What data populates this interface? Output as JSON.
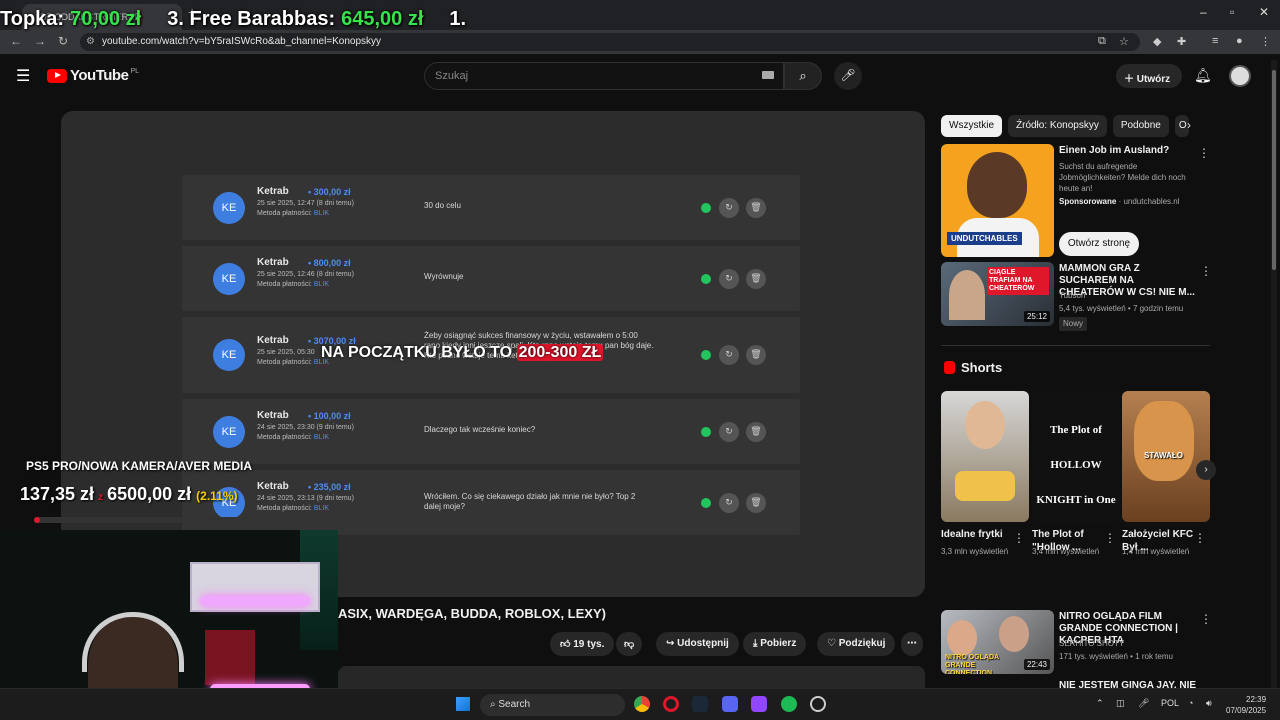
{
  "browser": {
    "tab_title": "DZ ODDAL STRIMERCE",
    "url": "youtube.com/watch?v=bY5raISWcRo&ab_channel=Konopskyy"
  },
  "overlay_top": {
    "label": "Topka:",
    "amount1": "70,00 zł",
    "entry3": "3. Free Barabbas:",
    "amount3": "645,00 zł",
    "entry1": "1."
  },
  "header": {
    "logo": "YouTube",
    "logo_country": "PL",
    "search_placeholder": "Szukaj",
    "create_label": "Utwórz"
  },
  "donations": [
    {
      "initials": "KE",
      "name": "Ketrab",
      "amount": "300,00 zł",
      "date": "25 sie 2025, 12:47 (8 dni temu)",
      "method_label": "Metoda płatności:",
      "method": "BLIK",
      "message": "30 do celu"
    },
    {
      "initials": "KE",
      "name": "Ketrab",
      "amount": "800,00 zł",
      "date": "25 sie 2025, 12:46 (8 dni temu)",
      "method_label": "Metoda płatności:",
      "method": "BLIK",
      "message": "Wyrównuje"
    },
    {
      "initials": "KE",
      "name": "Ketrab",
      "amount": "3070,00 zł",
      "date": "25 sie 2025, 05:30",
      "method_label": "Metoda płatności:",
      "method": "BLIK",
      "message": "Żeby osiągnąć sukces finansowy w życiu, wstawałem o 5:00 rano kiedy inni jeszcze spali. Kto rano wstaje temu pan bóg daje. Kto późno wstaje temu ketrab daje"
    },
    {
      "initials": "KE",
      "name": "Ketrab",
      "amount": "100,00 zł",
      "date": "24 sie 2025, 23:30 (9 dni temu)",
      "method_label": "Metoda płatności:",
      "method": "BLIK",
      "message": "Dlaczego tak wcześnie koniec?"
    },
    {
      "initials": "KE",
      "name": "Ketrab",
      "amount": "235,00 zł",
      "date": "24 sie 2025, 23:13 (9 dni temu)",
      "method_label": "Metoda płatności:",
      "method": "BLIK",
      "message": "Wróciłem. Co się ciekawego działo jak mnie nie było? Top 2 dalej moje?"
    }
  ],
  "caption": {
    "prefix": "NA POCZĄTKU BYŁO TO",
    "highlight": "200-300 ZŁ"
  },
  "video": {
    "title_partial": "ASIX, WARDĘGA, BUDDA, ROBLOX, LEXY)",
    "likes": "19 tys.",
    "share": "Udostępnij",
    "download": "Pobierz",
    "thanks": "Podziękuj"
  },
  "chips": [
    "Wszystkie",
    "Źródło: Konopskyy",
    "Podobne",
    "O"
  ],
  "ad": {
    "brand_logo": "UNDUTCHABLES",
    "title": "Einen Job im Ausland?",
    "description": "Suchst du aufregende Jobmöglichkeiten? Melde dich noch heute an!",
    "sponsored": "Sponsorowane",
    "domain": "undutchables.nl",
    "button": "Otwórz stronę"
  },
  "related": [
    {
      "title": "MAMMON GRA Z SUCHAREM NA CHEATERÓW W CS! NIE M...",
      "channel": "Tubson",
      "meta": "5,4 tys. wyświetleń • 7 godzin temu",
      "badge": "Nowy",
      "duration": "25:12",
      "thumb_text": "CIĄGLE TRAFIAM NA CHEATERÓW"
    },
    {
      "title": "NITRO OGLĄDA FILM GRANDE CONNECTION | KACPER HTA",
      "channel": "SERHITO SHOTY",
      "meta": "171 tys. wyświetleń • 1 rok temu",
      "duration": "22:43",
      "thumb_text": "NITRO OGLĄDA GRANDE CONNECTION"
    },
    {
      "title": "NIE JESTEM GINGA JAY, NIE"
    }
  ],
  "shorts": {
    "heading": "Shorts",
    "items": [
      {
        "title": "Idealne frytki",
        "views": "3,3 mln wyświetleń"
      },
      {
        "title": "The Plot of \"Hollow ...",
        "views": "3,4 mln wyświetleń",
        "thumb_text": "The Plot of HOLLOW KNIGHT in One Minute"
      },
      {
        "title": "Założyciel KFC Był ...",
        "views": "1,4 mln wyświetleń",
        "thumb_text": "STAWAŁO"
      }
    ]
  },
  "goal": {
    "title": "PS5 PRO/NOWA KAMERA/AVER MEDIA",
    "current": "137,35 zł",
    "separator": "z",
    "target": "6500,00 zł",
    "percent": "(2.11%)",
    "fraction": 0.0211
  },
  "taskbar": {
    "search": "Search",
    "lang": "POL",
    "time": "22:39",
    "date": "07/09/2025"
  }
}
